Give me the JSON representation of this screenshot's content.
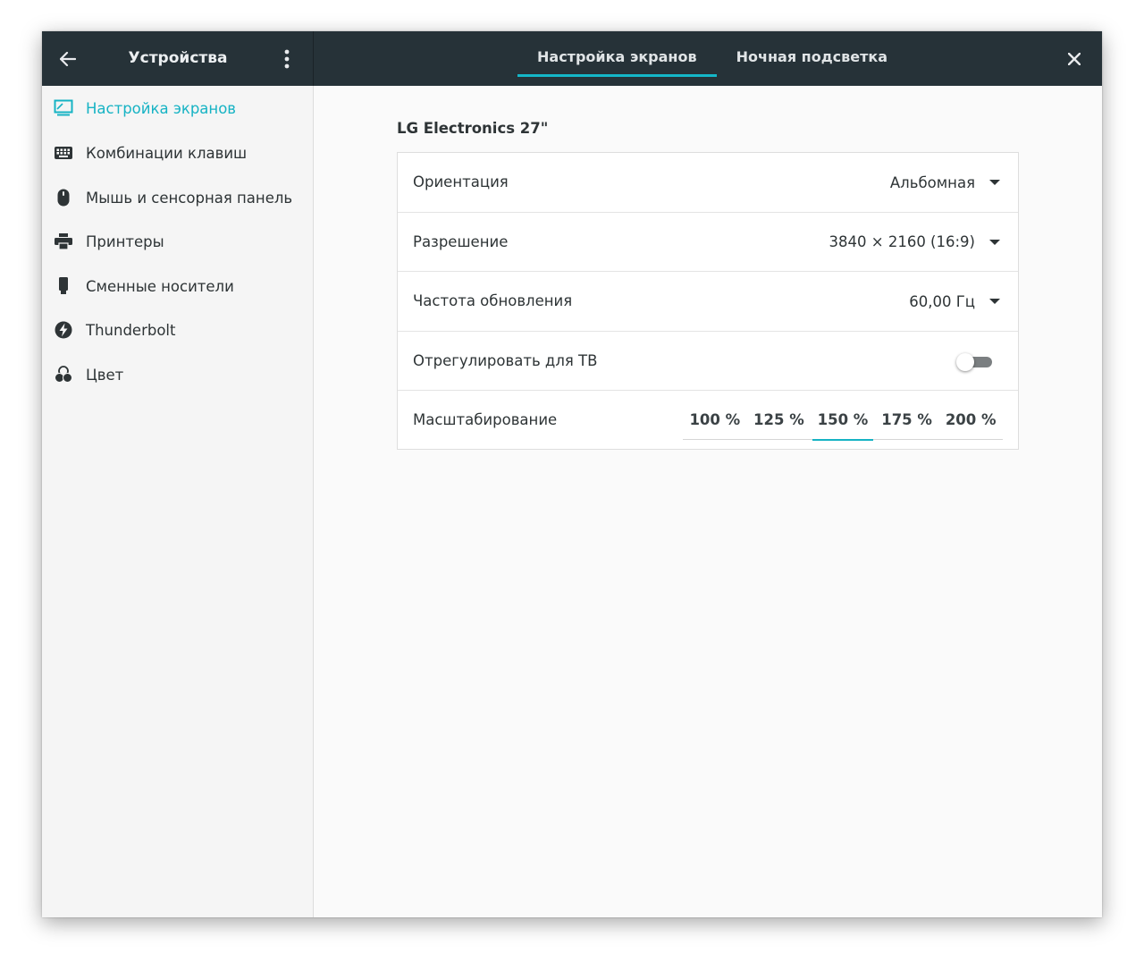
{
  "header": {
    "title": "Устройства",
    "tabs": [
      {
        "label": "Настройка экранов",
        "active": true
      },
      {
        "label": "Ночная подсветка",
        "active": false
      }
    ]
  },
  "sidebar": {
    "items": [
      {
        "label": "Настройка экранов",
        "icon": "display-icon",
        "active": true
      },
      {
        "label": "Комбинации клавиш",
        "icon": "keyboard-icon",
        "active": false
      },
      {
        "label": "Мышь и сенсорная панель",
        "icon": "mouse-icon",
        "active": false
      },
      {
        "label": "Принтеры",
        "icon": "printer-icon",
        "active": false
      },
      {
        "label": "Сменные носители",
        "icon": "usb-drive-icon",
        "active": false
      },
      {
        "label": "Thunderbolt",
        "icon": "thunderbolt-icon",
        "active": false
      },
      {
        "label": "Цвет",
        "icon": "color-icon",
        "active": false
      }
    ]
  },
  "display": {
    "name": "LG Electronics 27\"",
    "orientation": {
      "label": "Ориентация",
      "value": "Альбомная"
    },
    "resolution": {
      "label": "Разрешение",
      "value": "3840 × 2160 (16:9)"
    },
    "refresh_rate": {
      "label": "Частота обновления",
      "value": "60,00 Гц"
    },
    "tv_adjust": {
      "label": "Отрегулировать для ТВ",
      "enabled": false
    },
    "scaling": {
      "label": "Масштабирование",
      "options": [
        "100 %",
        "125 %",
        "150 %",
        "175 %",
        "200 %"
      ],
      "selected": "150 %"
    }
  },
  "colors": {
    "accent": "#16b3c4",
    "header_bg": "#263238",
    "sidebar_bg": "#f5f5f5"
  }
}
